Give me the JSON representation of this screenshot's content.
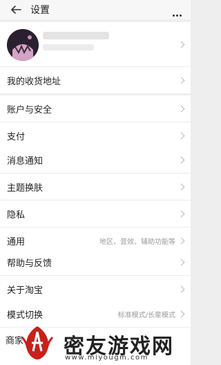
{
  "header": {
    "title": "设置"
  },
  "sections": [
    {
      "items": [
        {
          "label": "我的收货地址"
        }
      ]
    },
    {
      "items": [
        {
          "label": "账户与安全"
        },
        {
          "label": "支付"
        }
      ]
    },
    {
      "items": [
        {
          "label": "消息通知"
        },
        {
          "label": "主题换肤"
        },
        {
          "label": "隐私"
        },
        {
          "label": "通用",
          "value": "地区、音效、辅助功能等"
        }
      ]
    },
    {
      "items": [
        {
          "label": "帮助与反馈"
        },
        {
          "label": "关于淘宝"
        }
      ]
    },
    {
      "items": [
        {
          "label": "模式切换",
          "value": "标准模式/长辈模式"
        }
      ]
    }
  ],
  "partial_row": {
    "label": "商家"
  },
  "watermark": {
    "text": "密友游戏网",
    "url": "www.miyougm.com"
  }
}
